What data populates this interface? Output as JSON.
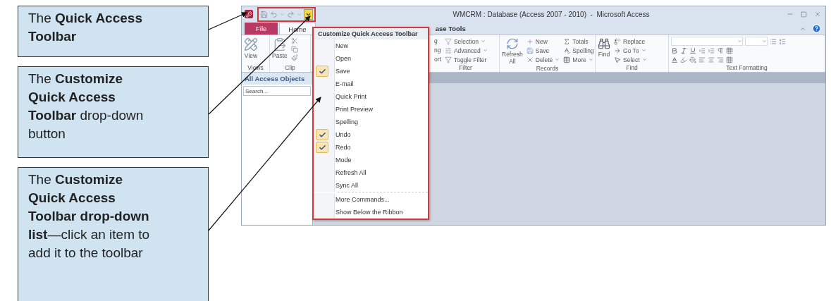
{
  "callouts": [
    {
      "text": "The **Quick Access Toolbar**"
    },
    {
      "text": "The **Customize Quick Access Toolbar** drop-down button"
    },
    {
      "text": "The **Customize Quick Access Toolbar drop-down list**—click an item to add it to the toolbar"
    }
  ],
  "window": {
    "title": "WMCRM : Database (Access 2007 - 2010)  -  Microsoft Access",
    "tabs": [
      {
        "label": "File",
        "kind": "file",
        "selected": false
      },
      {
        "label": "Home",
        "kind": "tab",
        "selected": true
      },
      {
        "label": "ase Tools",
        "kind": "tab",
        "selected": false
      }
    ],
    "ribbon": [
      {
        "kind": "views",
        "label": "Views",
        "texts": [
          "View"
        ]
      },
      {
        "kind": "clipboard",
        "label": "Clip",
        "texts": [
          "Paste"
        ]
      },
      {
        "kind": "filter",
        "label": "Filter",
        "texts": [
          "g",
          "ng",
          "ort",
          "Selection",
          "Advanced",
          "Toggle Filter"
        ]
      },
      {
        "kind": "records",
        "label": "Records",
        "texts": [
          "Refresh All",
          "New",
          "Save",
          "Delete",
          "Totals",
          "Spelling",
          "More"
        ]
      },
      {
        "kind": "find",
        "label": "Find",
        "texts": [
          "Find",
          "Replace",
          "Go To",
          "Select"
        ]
      },
      {
        "kind": "text",
        "label": "Text Formatting"
      }
    ],
    "nav": {
      "header": "All Access Objects",
      "search": {
        "placeholder": "Search..."
      }
    },
    "menu": {
      "title": "Customize Quick Access Toolbar",
      "items": [
        {
          "label": "New",
          "checked": false
        },
        {
          "label": "Open",
          "checked": false
        },
        {
          "label": "Save",
          "checked": true
        },
        {
          "label": "E-mail",
          "checked": false
        },
        {
          "label": "Quick Print",
          "checked": false
        },
        {
          "label": "Print Preview",
          "checked": false
        },
        {
          "label": "Spelling",
          "checked": false
        },
        {
          "label": "Undo",
          "checked": true
        },
        {
          "label": "Redo",
          "checked": true
        },
        {
          "label": "Mode",
          "checked": false
        },
        {
          "label": "Refresh All",
          "checked": false
        },
        {
          "label": "Sync All",
          "checked": false
        }
      ],
      "commands": [
        "More Commands...",
        "Show Below the Ribbon"
      ]
    }
  }
}
